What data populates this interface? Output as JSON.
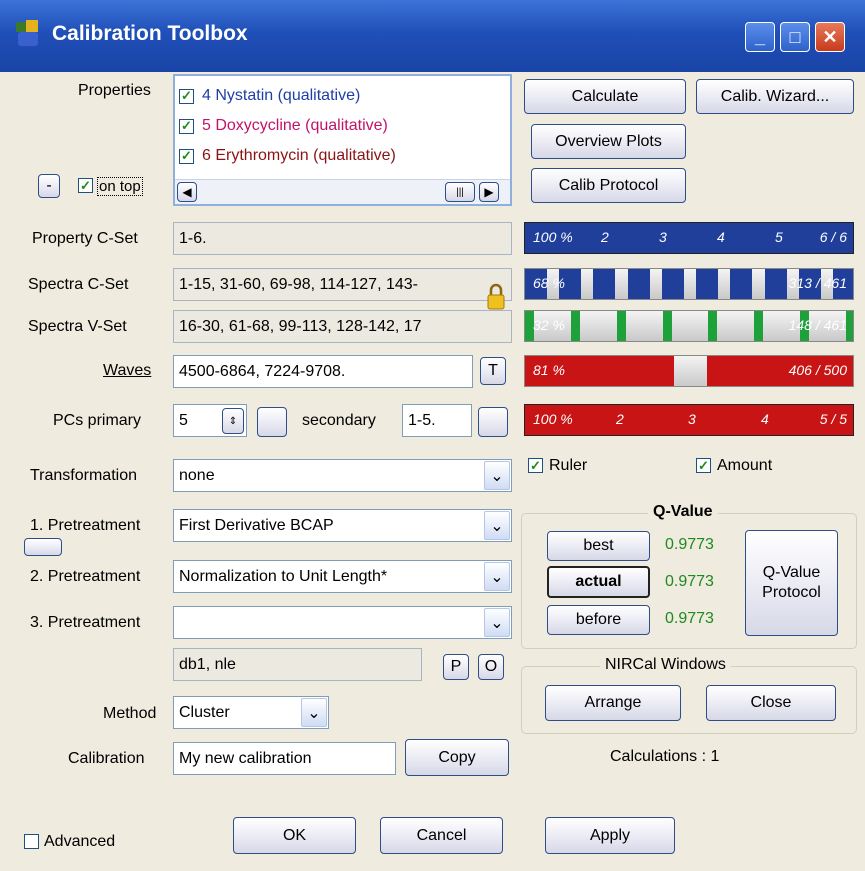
{
  "window": {
    "title": "Calibration Toolbox",
    "min": "_",
    "max": "□",
    "close": "✕"
  },
  "properties": {
    "label": "Properties",
    "items": [
      {
        "text": "4 Nystatin (qualitative)",
        "color": "#1f3fa6",
        "checked": true
      },
      {
        "text": "5 Doxycycline (qualitative)",
        "color": "#c0146b",
        "checked": true
      },
      {
        "text": "6 Erythromycin (qualitative)",
        "color": "#8a1414",
        "checked": true
      }
    ],
    "minus": "-",
    "on_top": "on top"
  },
  "buttons": {
    "calculate": "Calculate",
    "calib_wizard": "Calib. Wizard...",
    "overview_plots": "Overview Plots",
    "calib_protocol": "Calib Protocol",
    "copy": "Copy",
    "ok": "OK",
    "cancel": "Cancel",
    "apply": "Apply",
    "best": "best",
    "actual": "actual",
    "before": "before",
    "qvalue_protocol": "Q-Value Protocol",
    "arrange": "Arrange",
    "close": "Close",
    "t": "T",
    "p": "P",
    "o": "O"
  },
  "fields": {
    "property_cset": {
      "label": "Property C-Set",
      "value": "1-6."
    },
    "spectra_cset": {
      "label": "Spectra C-Set",
      "value": "1-15, 31-60, 69-98, 114-127, 143-"
    },
    "spectra_vset": {
      "label": "Spectra V-Set",
      "value": "16-30, 61-68, 99-113, 128-142, 17"
    },
    "waves": {
      "label": "Waves",
      "value": "4500-6864, 7224-9708."
    },
    "pcs_primary": {
      "label": "PCs primary",
      "value": "5"
    },
    "secondary": {
      "label": "secondary",
      "value": "1-5."
    },
    "transformation": {
      "label": "Transformation",
      "value": "none"
    },
    "pretreatment1": {
      "label": "1. Pretreatment",
      "value": "First Derivative BCAP"
    },
    "pretreatment2": {
      "label": "2. Pretreatment",
      "value": "Normalization to Unit Length*"
    },
    "pretreatment3": {
      "label": "3. Pretreatment",
      "value": ""
    },
    "db": {
      "value": "db1, nle"
    },
    "method": {
      "label": "Method",
      "value": "Cluster"
    },
    "calibration": {
      "label": "Calibration",
      "value": "My new calibration"
    }
  },
  "bars": {
    "property": {
      "left_text": "100 %",
      "ticks": [
        "2",
        "3",
        "4",
        "5"
      ],
      "right_text": "6 / 6",
      "fraction": 1.0,
      "color": "#1f3f9a"
    },
    "cset": {
      "left_text": "68 %",
      "right_text": "313 / 461",
      "fraction": 0.68,
      "color": "#1f3f9a"
    },
    "vset": {
      "left_text": "32 %",
      "right_text": "148 / 461",
      "fraction": 0.32,
      "color": "#1ea03a"
    },
    "waves": {
      "left_text": "81 %",
      "right_text": "406 / 500",
      "fraction": 0.81,
      "color": "#c81414"
    },
    "pcs": {
      "left_text": "100 %",
      "ticks": [
        "2",
        "3",
        "4"
      ],
      "right_text": "5 / 5",
      "fraction": 1.0,
      "color": "#c81414"
    }
  },
  "options": {
    "ruler": "Ruler",
    "amount": "Amount",
    "advanced": "Advanced"
  },
  "qvalue": {
    "title": "Q-Value",
    "best": "0.9773",
    "actual": "0.9773",
    "before": "0.9773"
  },
  "nircal": {
    "title": "NIRCal Windows"
  },
  "calculations": "Calculations : 1"
}
